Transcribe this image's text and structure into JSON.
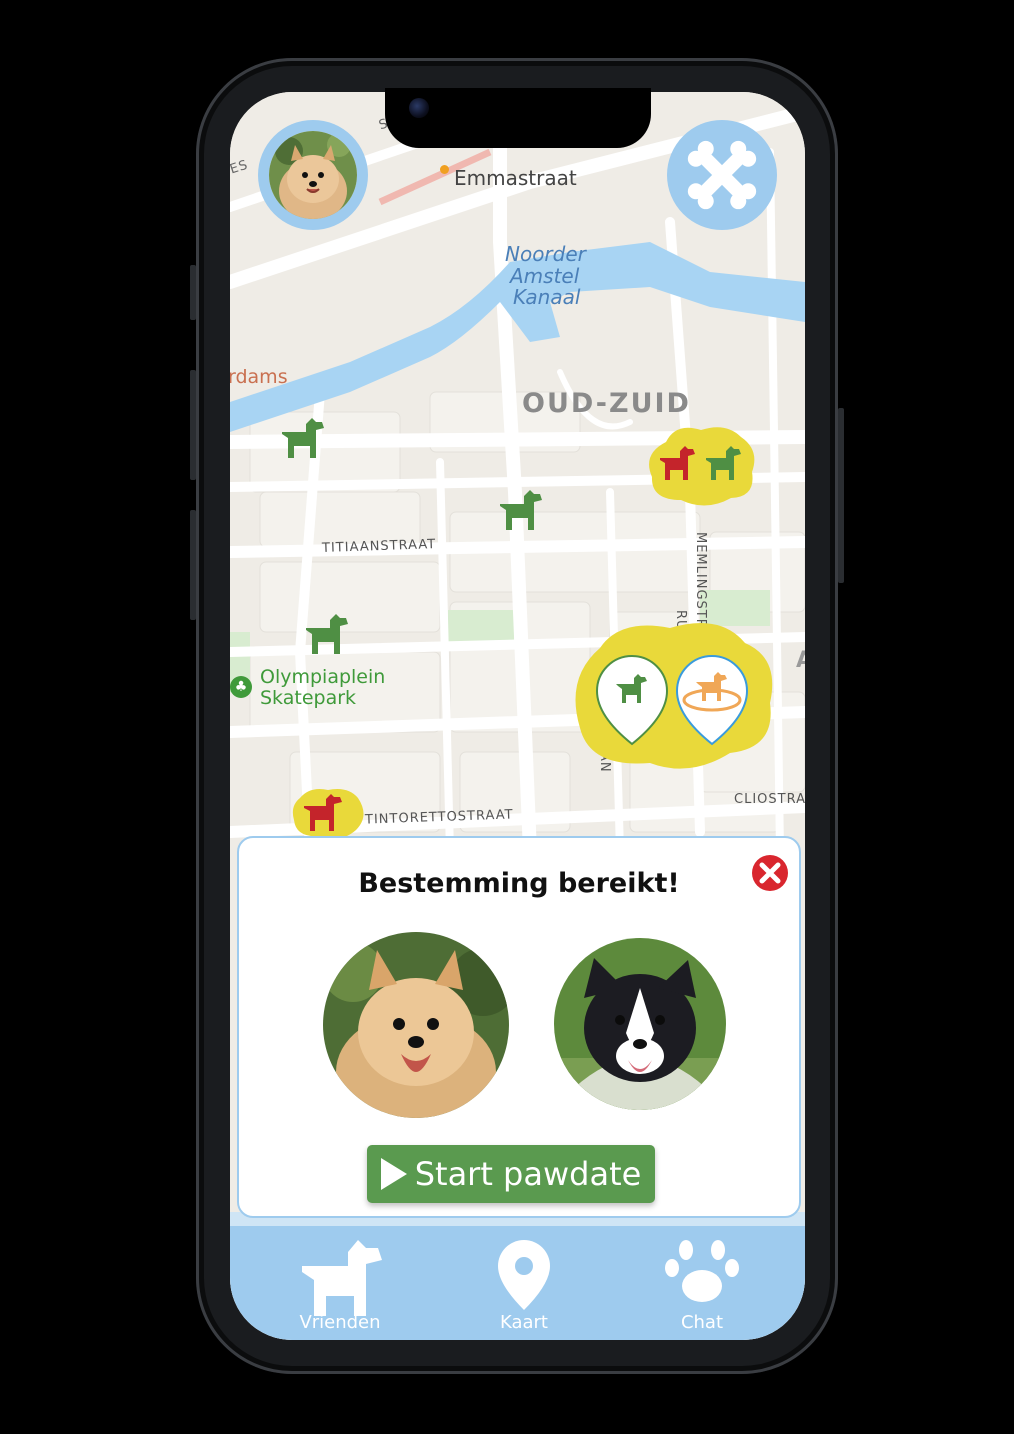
{
  "map": {
    "labels": {
      "emmastraat": "Emmastraat",
      "canal_line1": "Noorder",
      "canal_line2": "Amstel",
      "canal_line3": "Kanaal",
      "district": "OUD-ZUID",
      "rdams": "rdams",
      "titiaanstraat": "TITIAANSTRAAT",
      "memlingstraat": "MEMLINGSTRAAT",
      "olympiaplein_line1": "Olympiaplein",
      "olympiaplein_line2": "Skatepark",
      "tintorettostraat": "TINTORETTOSTRAAT",
      "cliostraat": "CLIOSTRA",
      "ru": "RU",
      "an": "AN",
      "aa_edge": "A",
      "straat_top": "STRAAT",
      "es_top": "ES"
    }
  },
  "header": {
    "profile_avatar_icon": "pomeranian-avatar",
    "menu_icon": "bone-cross-icon"
  },
  "popup": {
    "title": "Bestemming bereikt!",
    "start_label": "Start pawdate",
    "close_icon": "close-x-icon"
  },
  "tabbar": {
    "items": [
      {
        "label": "Vrienden",
        "icon": "dog-icon"
      },
      {
        "label": "Kaart",
        "icon": "map-pin-icon"
      },
      {
        "label": "Chat",
        "icon": "paw-icon"
      }
    ]
  },
  "colors": {
    "accent_blue": "#9ecbee",
    "dog_green": "#4f8f44",
    "dog_red": "#c4242b",
    "dog_orange": "#f0a757",
    "marker_yellow": "#e9d93a",
    "button_green": "#5a9a4f",
    "canal_blue": "#a8d4f3"
  }
}
